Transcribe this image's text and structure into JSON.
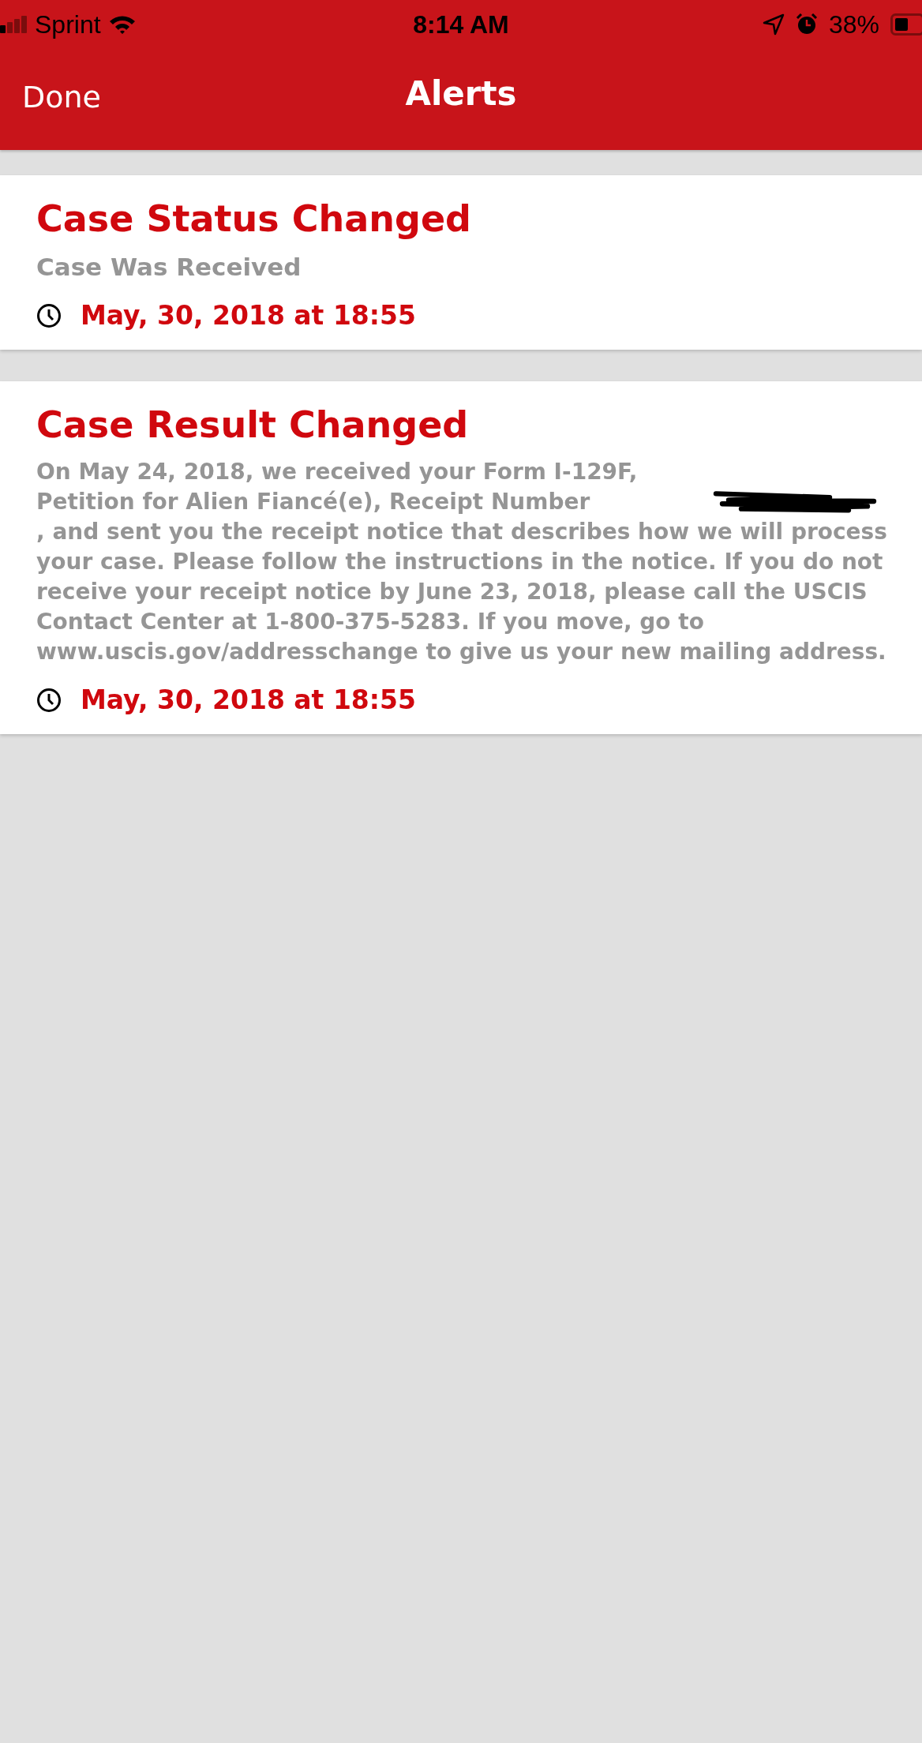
{
  "status_bar": {
    "carrier": "Sprint",
    "time": "8:14 AM",
    "battery": "38%"
  },
  "nav_bar": {
    "left_button": "Done",
    "title": "Alerts"
  },
  "alerts": [
    {
      "title": "Case Status Changed",
      "body_parts": [
        "Case Was Received"
      ],
      "timestamp": "May, 30, 2018 at 18:55"
    },
    {
      "title": "Case Result Changed",
      "body_parts": [
        "On May 24, 2018, we received your Form I-129F, Petition for Alien Fiancé(e), Receipt Number",
        ", and sent you the receipt notice that describes how we will process your case. Please follow the instructions in the notice. If you do not receive your receipt notice by June 23, 2018, please call the USCIS Contact Center at 1-800-375-5283. If you move, go to www.uscis.gov/addresschange to give us your new mailing address."
      ],
      "timestamp": "May, 30, 2018 at 18:55"
    }
  ]
}
